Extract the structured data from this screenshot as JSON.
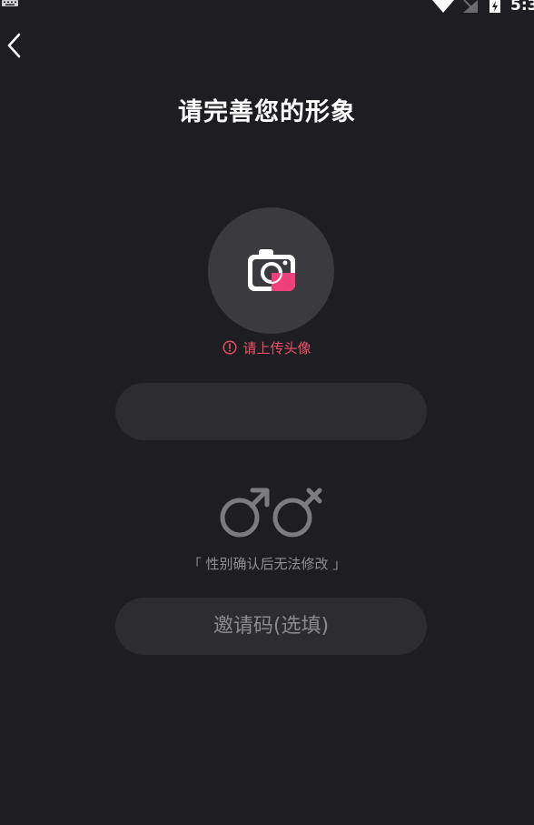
{
  "status_bar": {
    "time": "5:3",
    "icons": [
      "keyboard-icon",
      "wifi-icon",
      "signal-icon",
      "battery-charging-icon"
    ]
  },
  "header": {
    "back_icon": "chevron-left-icon",
    "title": "请完善您的形象"
  },
  "avatar": {
    "icon": "camera-icon",
    "hint": "请上传头像",
    "hint_icon": "warning-circle-icon"
  },
  "nickname": {
    "value": "",
    "placeholder": ""
  },
  "gender": {
    "options": [
      "male-icon",
      "female-icon"
    ],
    "note": "「 性别确认后无法修改 」"
  },
  "invite": {
    "value": "",
    "placeholder": "邀请码(选填)"
  },
  "colors": {
    "background": "#1e1e22",
    "field": "#2c2c31",
    "avatar_circle": "#3a3a3f",
    "warning": "#ee4f6c",
    "camera_accent": "#f03f7a",
    "muted_text": "#8e8e93"
  }
}
